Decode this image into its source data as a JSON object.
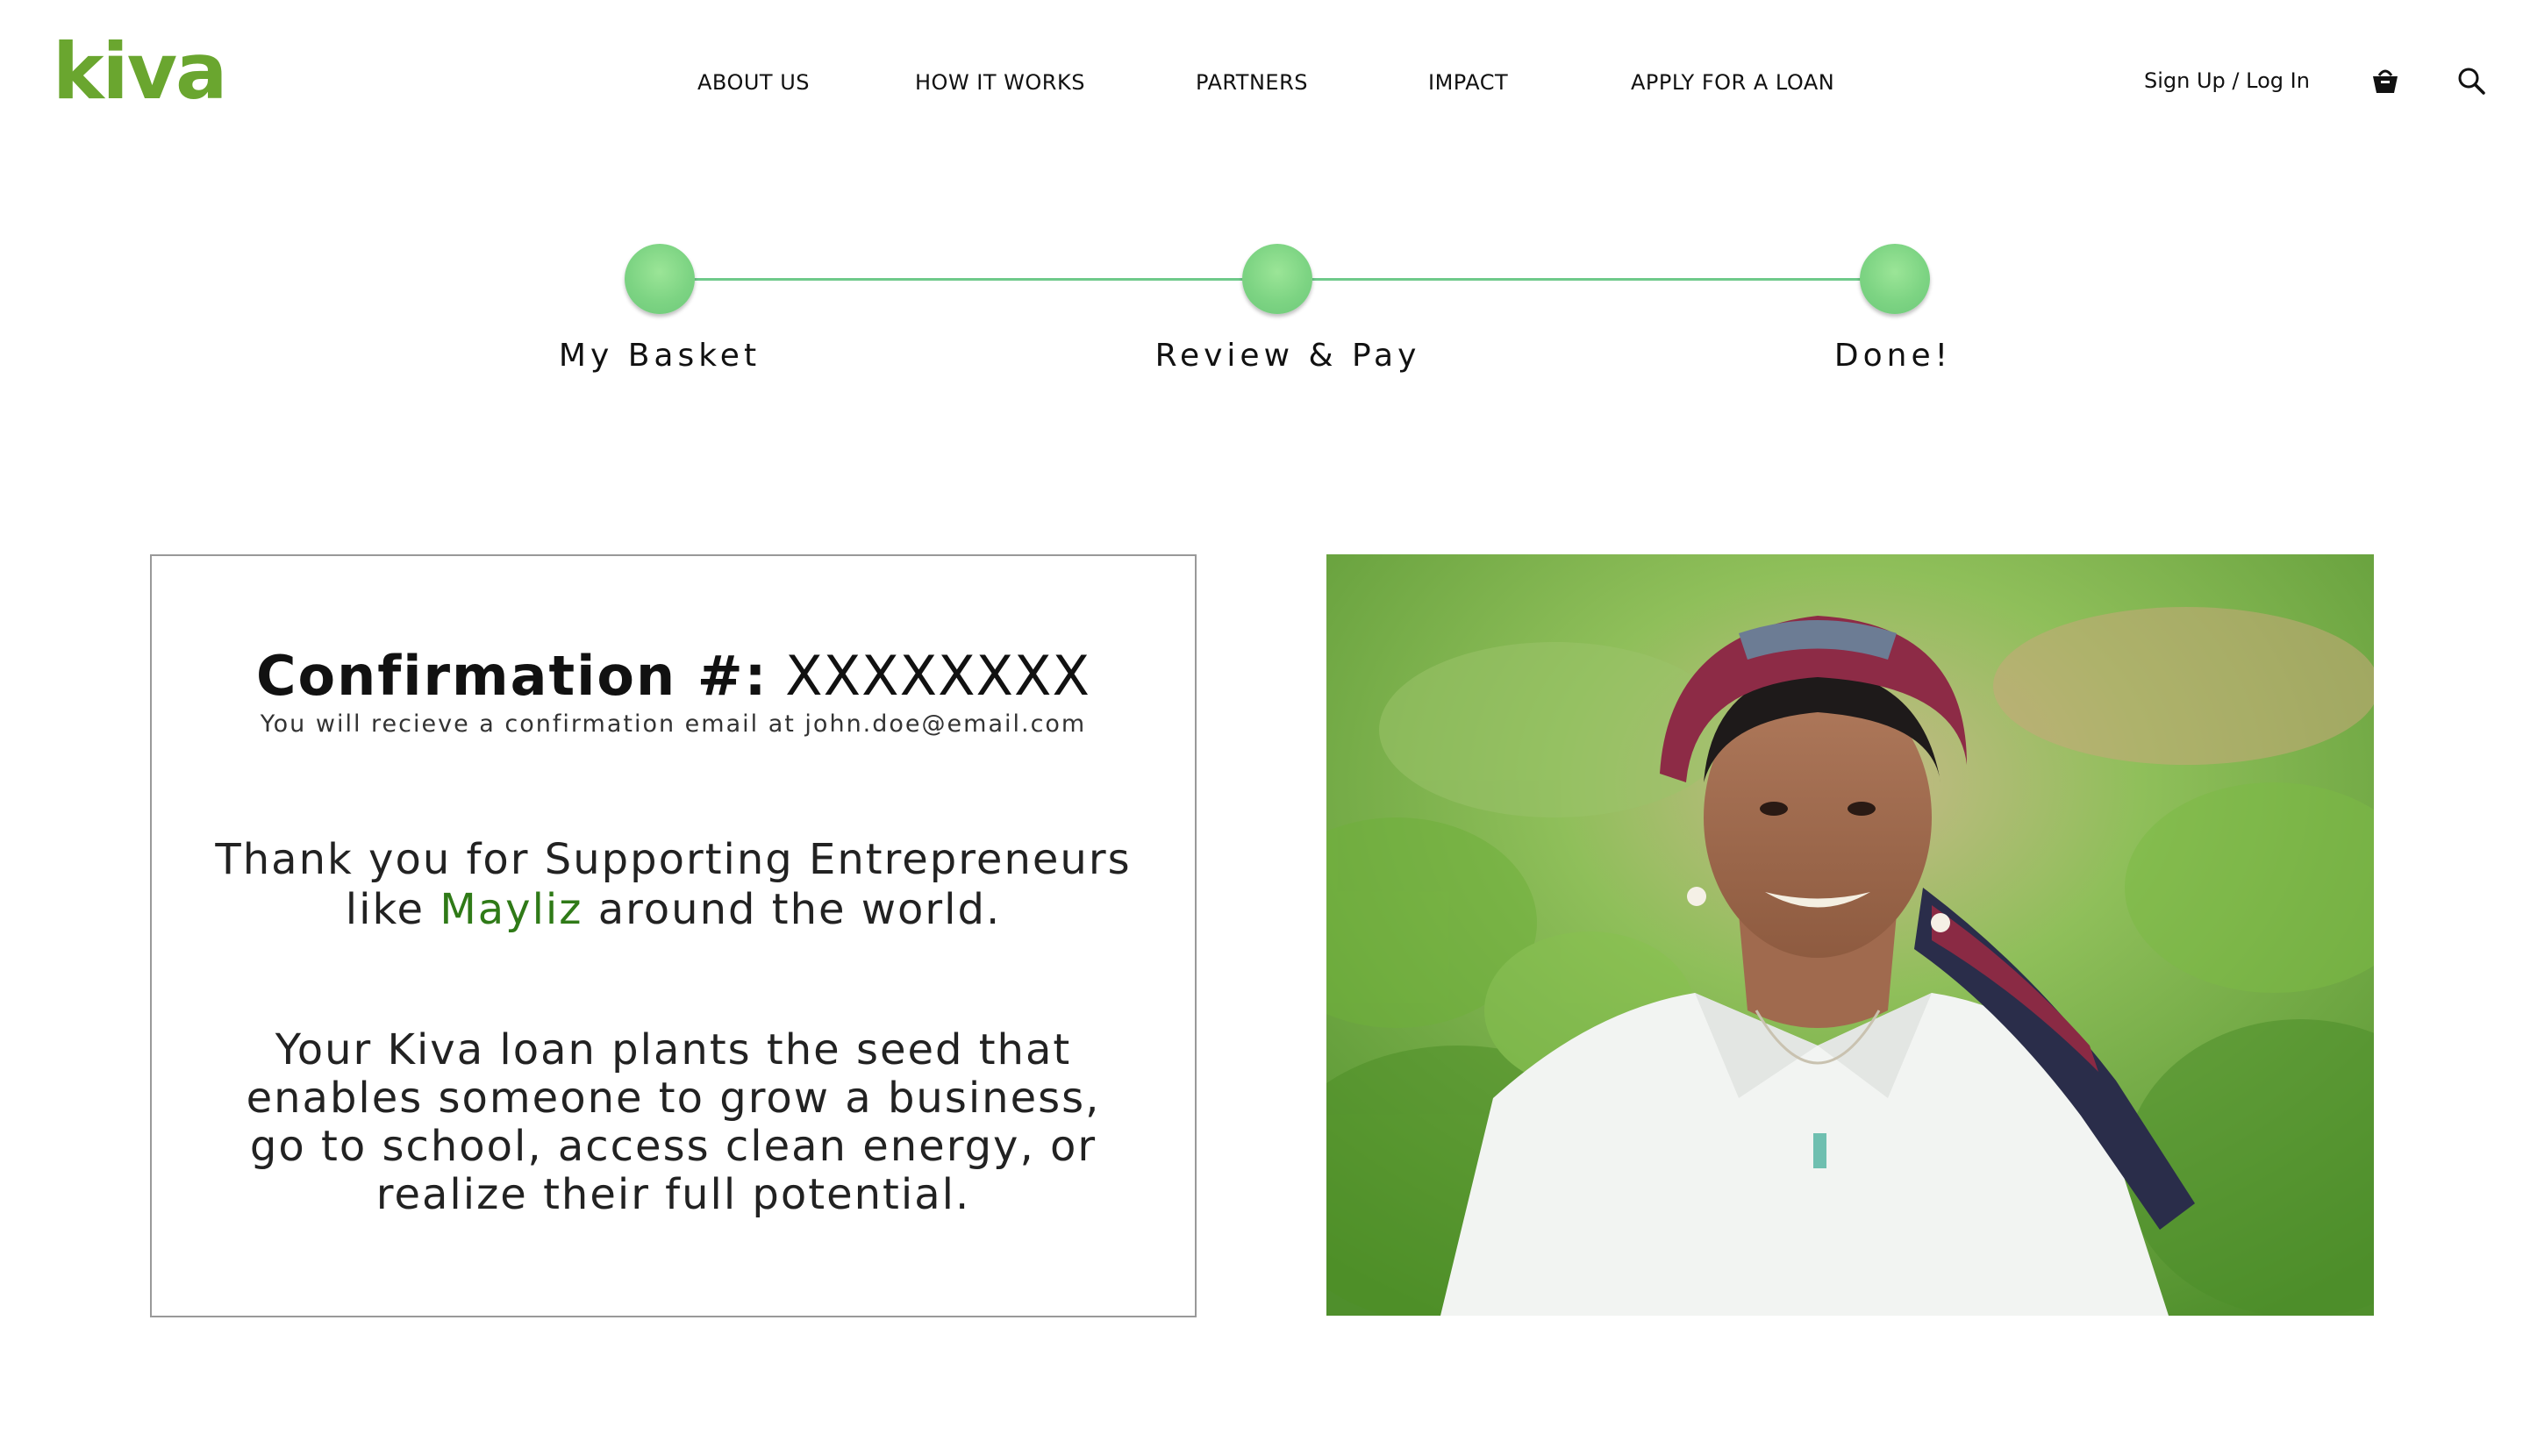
{
  "brand": {
    "logo_text": "kiva",
    "brand_color": "#6aa62f",
    "accent_green": "#2f7a17"
  },
  "nav": {
    "items": [
      "ABOUT US",
      "HOW IT WORKS",
      "PARTNERS",
      "IMPACT",
      "APPLY FOR A LOAN"
    ],
    "account_link": "Sign Up / Log In",
    "basket_icon": "basket-icon",
    "search_icon": "search-icon"
  },
  "stepper": {
    "steps": [
      "My Basket",
      "Review & Pay",
      "Done!"
    ],
    "dot_color": "#7dd483",
    "line_color": "#6ec98a"
  },
  "confirmation": {
    "label": "Confirmation #:",
    "number": "XXXXXXXX",
    "email_text": "You will recieve a confirmation email at john.doe@email.com",
    "thanks_line1": "Thank you for Supporting Entrepreneurs",
    "thanks_line2_prefix": "like ",
    "entrepreneur_name": "Mayliz",
    "thanks_line2_suffix": " around the world.",
    "mission_lines": [
      "Your Kiva loan plants the seed that",
      "enables someone to grow a business,",
      "go to school, access clean energy, or",
      "realize their full potential."
    ]
  },
  "photo": {
    "subject": "Mayliz"
  }
}
